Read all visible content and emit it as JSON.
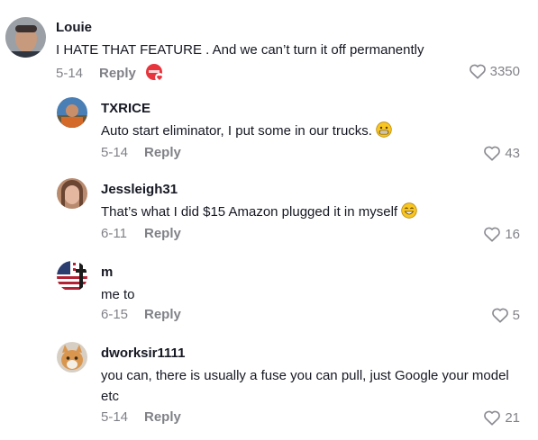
{
  "comments": [
    {
      "username": "Louie",
      "text": "I HATE THAT FEATURE . And we can’t turn it off permanently",
      "date": "5-14",
      "reply": "Reply",
      "likes": "3350"
    },
    {
      "username": "TXRICE",
      "text": "Auto start eliminator, I put some in our trucks.",
      "date": "5-14",
      "reply": "Reply",
      "likes": "43"
    },
    {
      "username": "Jessleigh31",
      "text": "That’s what I did $15 Amazon plugged it in myself",
      "date": "6-11",
      "reply": "Reply",
      "likes": "16"
    },
    {
      "username": "m",
      "text": "me to",
      "date": "6-15",
      "reply": "Reply",
      "likes": "5"
    },
    {
      "username": "dworksir1111",
      "text": "you can, there is usually a fuse you can pull, just Google your model etc",
      "date": "5-14",
      "reply": "Reply",
      "likes": "21"
    }
  ],
  "colors": {
    "primary_text": "#161823",
    "muted_text": "#8a8b91",
    "creator_badge": "#e8343c"
  },
  "icons": [
    "heart-icon",
    "grin-emoji-icon",
    "smile-emoji-icon",
    "creator-liked-badge-icon"
  ]
}
